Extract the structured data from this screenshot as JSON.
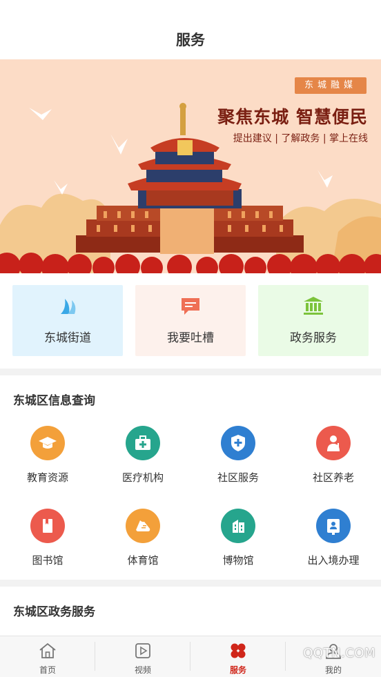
{
  "header": {
    "title": "服务"
  },
  "banner": {
    "brand": "东城融媒",
    "headline": "聚焦东城 智慧便民",
    "tagline": "提出建议 | 了解政务 | 掌上在线"
  },
  "quick_cards": [
    {
      "label": "东城街道",
      "bg": "#e1f3fd",
      "icon": "wave-icon",
      "color": "#3aa8e6"
    },
    {
      "label": "我要吐槽",
      "bg": "#fdf1ec",
      "icon": "chat-bubble-icon",
      "color": "#ef6f55"
    },
    {
      "label": "政务服务",
      "bg": "#eafbe6",
      "icon": "government-building-icon",
      "color": "#7cc33b"
    }
  ],
  "info_section": {
    "title": "东城区信息查询",
    "items": [
      {
        "label": "教育资源",
        "icon": "graduation-cap-icon",
        "color": "#f3a03a"
      },
      {
        "label": "医疗机构",
        "icon": "medical-kit-icon",
        "color": "#26a58d"
      },
      {
        "label": "社区服务",
        "icon": "shield-plus-icon",
        "color": "#2f7fd1"
      },
      {
        "label": "社区养老",
        "icon": "elderly-person-icon",
        "color": "#ec5a4d"
      },
      {
        "label": "图书馆",
        "icon": "book-icon",
        "color": "#ec5a4d"
      },
      {
        "label": "体育馆",
        "icon": "sneaker-icon",
        "color": "#f3a03a"
      },
      {
        "label": "博物馆",
        "icon": "building-icon",
        "color": "#26a58d"
      },
      {
        "label": "出入境办理",
        "icon": "id-card-icon",
        "color": "#2f7fd1"
      }
    ]
  },
  "gov_section": {
    "title": "东城区政务服务"
  },
  "tabbar": {
    "tabs": [
      {
        "label": "首页",
        "icon": "home-icon",
        "active": false
      },
      {
        "label": "视频",
        "icon": "video-play-icon",
        "active": false
      },
      {
        "label": "服务",
        "icon": "services-icon",
        "active": true
      },
      {
        "label": "我的",
        "icon": "user-icon",
        "active": false
      }
    ]
  },
  "watermark": "QQTN.COM",
  "colors": {
    "accent": "#d0261a",
    "banner_bg": "#fcdcc6",
    "banner_text": "#7a1f12"
  }
}
